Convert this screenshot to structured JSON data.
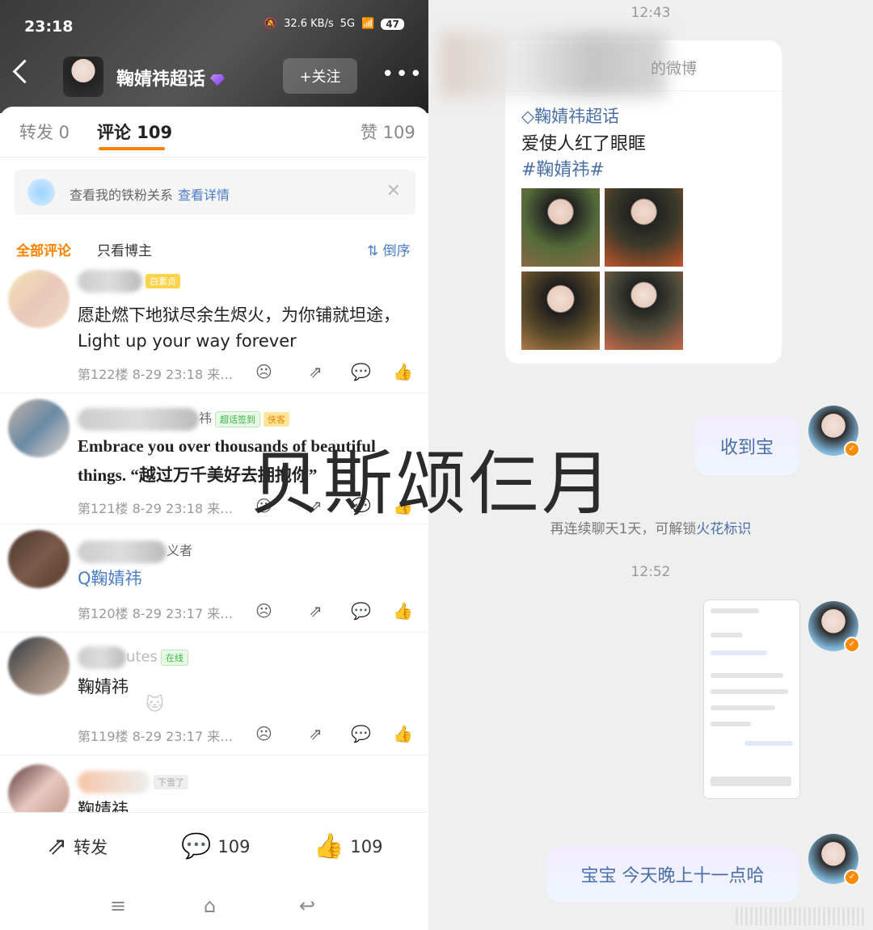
{
  "status_bar": {
    "time": "23:18",
    "speed": "32.6 KB/s",
    "signal": "5G",
    "battery": "47"
  },
  "header": {
    "title": "鞠婧祎超话",
    "follow_label": "+关注",
    "more": "•••"
  },
  "tabs": [
    {
      "label": "转发 0"
    },
    {
      "label": "评论 109"
    },
    {
      "label": "赞 109"
    }
  ],
  "fanbar": {
    "text": "查看我的铁粉关系",
    "link": "查看详情",
    "close": "✕"
  },
  "filters": {
    "all": "全部评论",
    "owner_only": "只看博主",
    "sort": "⇅ 倒序"
  },
  "comments": [
    {
      "badge": "白素贞",
      "text_line1": "愿赴燃下地狱尽余生烬火，为你铺就坦途，",
      "text_line2": "Light up your way forever",
      "meta": "第122楼  8-29 23:18  来…"
    },
    {
      "name_visible": "祎",
      "badge1": "超话签到",
      "badge2": "侠客",
      "text_line1": "Embrace you over thousands of beautiful",
      "text_line2": "things. “越过万千美好去拥抱你”",
      "meta": "第121楼  8-29 23:18  来…"
    },
    {
      "name_visible": "义者",
      "search_text": "Q鞠婧祎",
      "meta": "第120楼  8-29 23:17  来…"
    },
    {
      "name_visible": "utes",
      "badge": "在线",
      "text_line1": "鞠婧祎",
      "meta": "第119楼  8-29 23:17  来…"
    },
    {
      "badge": "下雪了",
      "text_line1": "鞠婧祎"
    }
  ],
  "bottom_bar": {
    "repost_label": "转发",
    "comment_count": "109",
    "like_count": "109"
  },
  "nav": {
    "menu": "≡",
    "home": "⌂",
    "back": "↩"
  },
  "chat": {
    "time1": "12:43",
    "card": {
      "header": "的微博",
      "topic": "◇鞠婧祎超话",
      "line": "爱使人红了眼眶",
      "tag": "#鞠婧祎#"
    },
    "sticker1": "收到宝",
    "hint_prefix": "再连续聊天1天，可解锁",
    "hint_link": "火花标识",
    "time2": "12:52",
    "sticker2": "宝宝 今天晚上十一点哈"
  },
  "watermark": "贝斯颂仨月"
}
